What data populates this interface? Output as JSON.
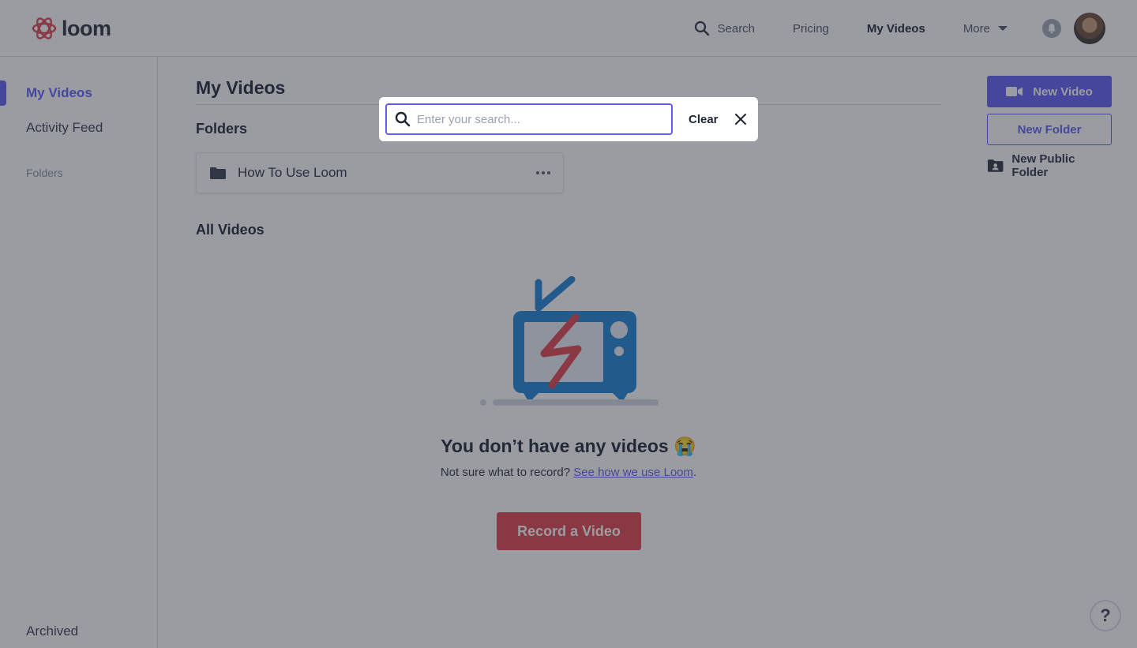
{
  "header": {
    "brand": "loom",
    "nav": {
      "search_label": "Search",
      "pricing_label": "Pricing",
      "my_videos_label": "My Videos",
      "more_label": "More"
    }
  },
  "sidebar": {
    "items": [
      {
        "label": "My Videos"
      },
      {
        "label": "Activity Feed"
      }
    ],
    "folders_heading": "Folders",
    "archived_label": "Archived"
  },
  "main": {
    "title": "My Videos",
    "folders_title": "Folders",
    "folders": [
      {
        "name": "How To Use Loom"
      }
    ],
    "all_videos_title": "All Videos",
    "empty_state": {
      "title": "You don’t have any videos 😭",
      "subtitle_prefix": "Not sure what to record? ",
      "link_text": "See how we use Loom",
      "subtitle_suffix": ".",
      "record_button": "Record a Video"
    }
  },
  "actions": {
    "new_video": "New Video",
    "new_folder": "New Folder",
    "new_public_folder": "New Public Folder"
  },
  "help": {
    "label": "?"
  },
  "search_modal": {
    "placeholder": "Enter your search...",
    "value": "",
    "clear_label": "Clear"
  },
  "colors": {
    "accent": "#625df5",
    "record": "#e0454f",
    "brand_logo": "#e0454f",
    "overlay": "rgba(40, 44, 58, 0.47)"
  },
  "icons": {
    "logo": "loom-flower-icon",
    "search": "search-icon",
    "more": "caret-down-icon",
    "notifications": "bell-icon",
    "folder": "folder-icon",
    "folder_menu": "more-dots-icon",
    "new_video": "video-camera-icon",
    "public_folder": "shared-folder-icon",
    "close": "close-icon"
  }
}
